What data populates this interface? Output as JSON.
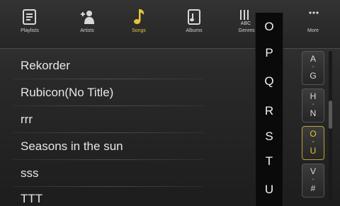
{
  "tabs": [
    {
      "label": "Playlists",
      "icon": "playlist-icon"
    },
    {
      "label": "Artists",
      "icon": "artist-icon"
    },
    {
      "label": "Songs",
      "icon": "music-note-icon",
      "active": true
    },
    {
      "label": "Albums",
      "icon": "album-icon"
    },
    {
      "label": "Genres",
      "icon": "genre-icon"
    },
    {
      "label": "More",
      "icon": "more-icon"
    }
  ],
  "songs": [
    "Rekorder",
    "Rubicon(No Title)",
    "rrr",
    "Seasons in the sun",
    "sss",
    "TTT"
  ],
  "letter_popup": [
    "O",
    "P",
    "Q",
    "R",
    "S",
    "T",
    "U"
  ],
  "index": [
    {
      "top": "A",
      "mid": "-",
      "bottom": "G"
    },
    {
      "top": "H",
      "mid": "-",
      "bottom": "N"
    },
    {
      "top": "O",
      "mid": "-",
      "bottom": "U",
      "active": true
    },
    {
      "top": "V",
      "mid": "-",
      "bottom": "#"
    }
  ],
  "colors": {
    "accent": "#e6c43a",
    "background": "#1d1d1d"
  }
}
